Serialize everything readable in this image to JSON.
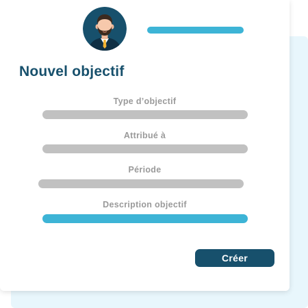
{
  "colors": {
    "primary": "#17506c",
    "accent": "#3db4d6",
    "placeholder_bar": "#c1c1c1",
    "label": "#9a9a9a",
    "back_card": "#e8f6fc"
  },
  "header": {
    "avatar_icon": "user-avatar-icon"
  },
  "form": {
    "title": "Nouvel objectif",
    "fields": [
      {
        "label": "Type d’objectif"
      },
      {
        "label": "Attribué à"
      },
      {
        "label": "Période"
      },
      {
        "label": "Description objectif",
        "active": true
      }
    ],
    "submit_label": "Créer"
  }
}
